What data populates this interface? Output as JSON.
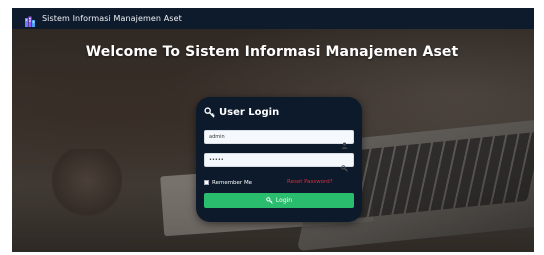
{
  "navbar": {
    "brand_icon": "building-logo-icon",
    "title": "Sistem Informasi Manajemen Aset"
  },
  "hero": {
    "welcome": "Welcome To Sistem Informasi Manajemen Aset"
  },
  "login": {
    "title_icon": "key-icon",
    "title": "User Login",
    "username": {
      "value": "admin",
      "icon": "user-icon"
    },
    "password": {
      "value": "•••••",
      "icon": "key-icon"
    },
    "remember_label": "Remember Me",
    "reset_label": "Reset Password?",
    "button_label": "Login",
    "button_icon": "key-icon"
  },
  "colors": {
    "navbar": "#0e1b2c",
    "card": "#0c1a2c",
    "button": "#2bbd6e",
    "reset_link": "#d32f3a"
  }
}
